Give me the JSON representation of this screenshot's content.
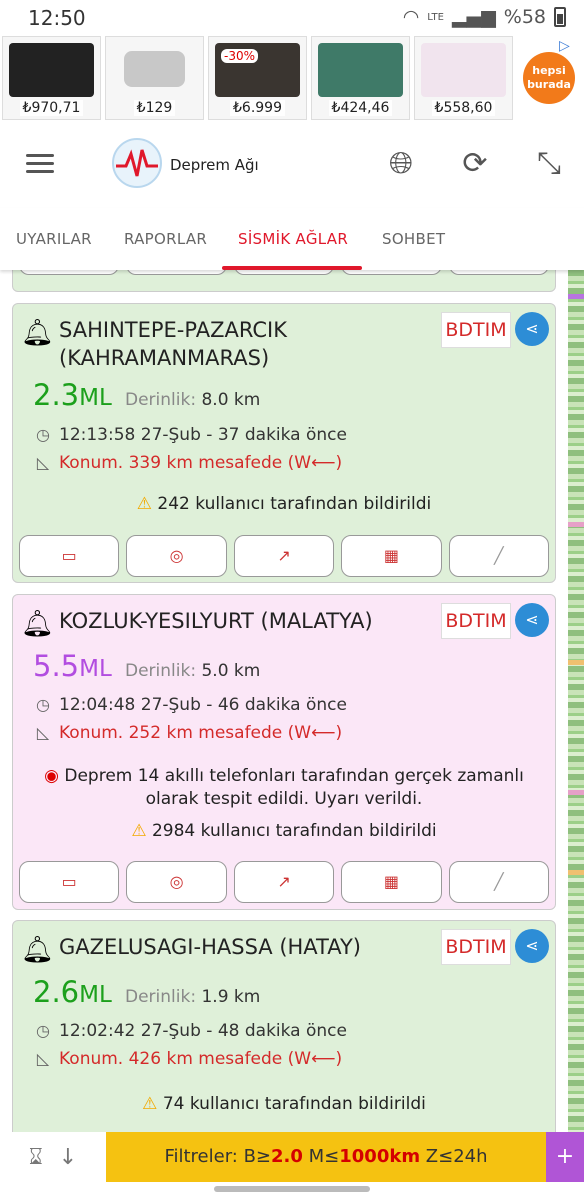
{
  "status": {
    "time": "12:50",
    "battery": "%58",
    "network": "LTE"
  },
  "ads": [
    {
      "price": "₺970,71"
    },
    {
      "price": "₺129"
    },
    {
      "price": "₺6.999",
      "discount": "-30%"
    },
    {
      "price": "₺424,46"
    },
    {
      "price": "₺558,60"
    }
  ],
  "ad_brand": "hepsi burada",
  "app": {
    "title": "Deprem Ağı"
  },
  "tabs": [
    "UYARILAR",
    "RAPORLAR",
    "SİSMİK AĞLAR",
    "SOHBET"
  ],
  "active_tab": "SİSMİK AĞLAR",
  "quakes": [
    {
      "place": "SAHINTEPE-PAZARCIK (KAHRAMANMARAS)",
      "source": "BDTIM",
      "magnitude": "2.3",
      "mag_unit": "ML",
      "depth_label": "Derinlik:",
      "depth": "8.0 km",
      "time": "12:13:58 27-Şub - 37 dakika önce",
      "location": "Konum. 339 km mesafede (W⟵)",
      "reports": "242 kullanıcı tarafından bildirildi",
      "color": "green"
    },
    {
      "place": "KOZLUK-YESILYURT (MALATYA)",
      "source": "BDTIM",
      "magnitude": "5.5",
      "mag_unit": "ML",
      "depth_label": "Derinlik:",
      "depth": "5.0 km",
      "time": "12:04:48 27-Şub - 46 dakika önce",
      "location": "Konum. 252 km mesafede (W⟵)",
      "alert": "Deprem 14 akıllı telefonları tarafından gerçek zamanlı olarak tespit edildi. Uyarı verildi.",
      "reports": "2984 kullanıcı tarafından bildirildi",
      "color": "pink"
    },
    {
      "place": "GAZELUSAGI-HASSA (HATAY)",
      "source": "BDTIM",
      "magnitude": "2.6",
      "mag_unit": "ML",
      "depth_label": "Derinlik:",
      "depth": "1.9 km",
      "time": "12:02:42 27-Şub - 48 dakika önce",
      "location": "Konum. 426 km mesafede (W⟵)",
      "reports": "74 kullanıcı tarafından bildirildi",
      "color": "green"
    }
  ],
  "filter": {
    "prefix": "Filtreler: B≥",
    "b": "2.0",
    "m_prefix": " M≤",
    "m": "1000km",
    "z": " Z≤24h",
    "plus": "+"
  },
  "colors": {
    "accent": "#e0182b",
    "filter_bg": "#f5c211",
    "plus_bg": "#b055d6",
    "share": "#2d8dd6"
  }
}
